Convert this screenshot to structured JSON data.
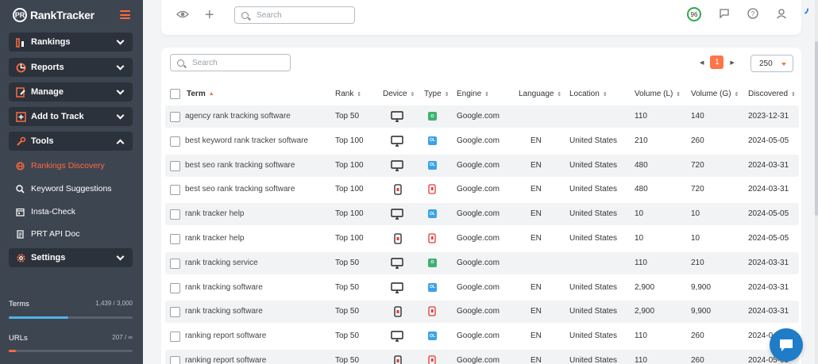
{
  "app": {
    "name": "RankTracker",
    "logo_glyph": "PR"
  },
  "sidebar": {
    "nav": [
      {
        "label": "Rankings",
        "icon": "rankings-icon"
      },
      {
        "label": "Reports",
        "icon": "reports-icon"
      },
      {
        "label": "Manage",
        "icon": "manage-icon"
      },
      {
        "label": "Add to Track",
        "icon": "add-icon"
      },
      {
        "label": "Tools",
        "icon": "tools-icon"
      },
      {
        "label": "Settings",
        "icon": "gear-icon"
      }
    ],
    "tools_sub": [
      {
        "label": "Rankings Discovery",
        "icon": "globe-icon",
        "active": true
      },
      {
        "label": "Keyword Suggestions",
        "icon": "search-icon",
        "active": false
      },
      {
        "label": "Insta-Check",
        "icon": "calendar-icon",
        "active": false
      },
      {
        "label": "PRT API Doc",
        "icon": "document-icon",
        "active": false
      }
    ],
    "stats": {
      "terms_label": "Terms",
      "terms_value": "1,439 / 3,000",
      "terms_progress": 0.48,
      "urls_label": "URLs",
      "urls_value": "207 / ∞",
      "urls_progress": 0.06
    }
  },
  "topbar": {
    "search_placeholder": "Search",
    "score": "96"
  },
  "table": {
    "search_placeholder": "Search",
    "current_page": "1",
    "per_page": "250",
    "headers": {
      "term": "Term",
      "rank": "Rank",
      "device": "Device",
      "type": "Type",
      "engine": "Engine",
      "language": "Language",
      "location": "Location",
      "volume_l": "Volume (L)",
      "volume_g": "Volume (G)",
      "discovered": "Discovered"
    },
    "rows": [
      {
        "term": "agency rank tracking software",
        "rank": "Top 50",
        "device": "desktop",
        "type": "O",
        "engine": "Google.com",
        "language": "",
        "location": "",
        "vol_l": "110",
        "vol_g": "140",
        "discovered": "2023-12-31"
      },
      {
        "term": "best keyword rank tracker software",
        "rank": "Top 100",
        "device": "desktop",
        "type": "OL",
        "engine": "Google.com",
        "language": "EN",
        "location": "United States",
        "vol_l": "210",
        "vol_g": "260",
        "discovered": "2024-05-05"
      },
      {
        "term": "best seo rank tracking software",
        "rank": "Top 100",
        "device": "desktop",
        "type": "OL",
        "engine": "Google.com",
        "language": "EN",
        "location": "United States",
        "vol_l": "480",
        "vol_g": "720",
        "discovered": "2024-03-31"
      },
      {
        "term": "best seo rank tracking software",
        "rank": "Top 100",
        "device": "mobile",
        "type": "mobile",
        "engine": "Google.com",
        "language": "EN",
        "location": "United States",
        "vol_l": "480",
        "vol_g": "720",
        "discovered": "2024-03-31"
      },
      {
        "term": "rank tracker help",
        "rank": "Top 100",
        "device": "desktop",
        "type": "OL",
        "engine": "Google.com",
        "language": "EN",
        "location": "United States",
        "vol_l": "10",
        "vol_g": "10",
        "discovered": "2024-05-05"
      },
      {
        "term": "rank tracker help",
        "rank": "Top 100",
        "device": "mobile",
        "type": "mobile",
        "engine": "Google.com",
        "language": "EN",
        "location": "United States",
        "vol_l": "10",
        "vol_g": "10",
        "discovered": "2024-05-05"
      },
      {
        "term": "rank tracking service",
        "rank": "Top 50",
        "device": "desktop",
        "type": "O",
        "engine": "Google.com",
        "language": "",
        "location": "",
        "vol_l": "110",
        "vol_g": "210",
        "discovered": "2024-03-31"
      },
      {
        "term": "rank tracking software",
        "rank": "Top 50",
        "device": "desktop",
        "type": "OL",
        "engine": "Google.com",
        "language": "EN",
        "location": "United States",
        "vol_l": "2,900",
        "vol_g": "9,900",
        "discovered": "2024-03-31"
      },
      {
        "term": "rank tracking software",
        "rank": "Top 50",
        "device": "mobile",
        "type": "mobile",
        "engine": "Google.com",
        "language": "EN",
        "location": "United States",
        "vol_l": "2,900",
        "vol_g": "9,900",
        "discovered": "2024-03-31"
      },
      {
        "term": "ranking report software",
        "rank": "Top 50",
        "device": "desktop",
        "type": "OL",
        "engine": "Google.com",
        "language": "EN",
        "location": "United States",
        "vol_l": "110",
        "vol_g": "260",
        "discovered": "2024-0"
      },
      {
        "term": "ranking report software",
        "rank": "Top 50",
        "device": "mobile",
        "type": "mobile",
        "engine": "Google.com",
        "language": "EN",
        "location": "United States",
        "vol_l": "110",
        "vol_g": "260",
        "discovered": "2024-05-05"
      }
    ]
  },
  "colors": {
    "accent": "#ff6a3d",
    "sidebar": "#3d4551",
    "nav_bg": "#2b323c",
    "type_O": "#3cb371",
    "type_OL": "#3aa3e8",
    "terms_bar": "#4fb3e8",
    "urls_bar": "#ff6a3d"
  }
}
